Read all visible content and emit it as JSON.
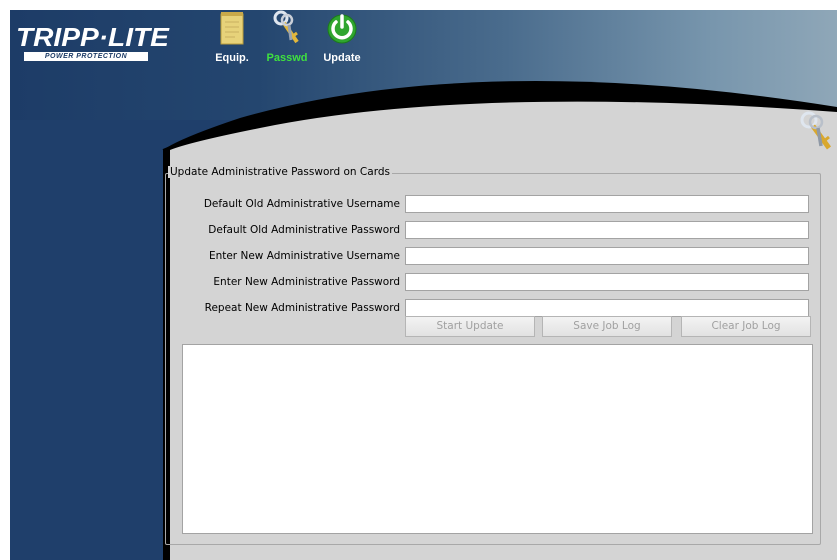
{
  "header": {
    "logo_text": "TRIPP·LITE",
    "logo_subtext": "POWER PROTECTION"
  },
  "toolbar": {
    "items": [
      {
        "label": "Equip.",
        "icon": "document-icon",
        "active": false
      },
      {
        "label": "Passwd",
        "icon": "keys-icon",
        "active": true
      },
      {
        "label": "Update",
        "icon": "power-icon",
        "active": false
      }
    ],
    "active_color": "#3fe03f"
  },
  "form": {
    "group_title": "Update Administrative Password on Cards",
    "fields": [
      {
        "label": "Default Old Administrative Username",
        "value": ""
      },
      {
        "label": "Default Old Administrative Password",
        "value": ""
      },
      {
        "label": "Enter New Administrative Username",
        "value": ""
      },
      {
        "label": "Enter New Administrative Password",
        "value": ""
      },
      {
        "label": "Repeat New Administrative Password",
        "value": ""
      }
    ],
    "buttons": {
      "start": "Start Update",
      "save": "Save Job Log",
      "clear": "Clear Job Log"
    },
    "log": ""
  },
  "colors": {
    "sidebar_blue": "#1f3f6b",
    "panel_gray": "#d4d4d4",
    "disabled_text": "#a0a0a0"
  }
}
